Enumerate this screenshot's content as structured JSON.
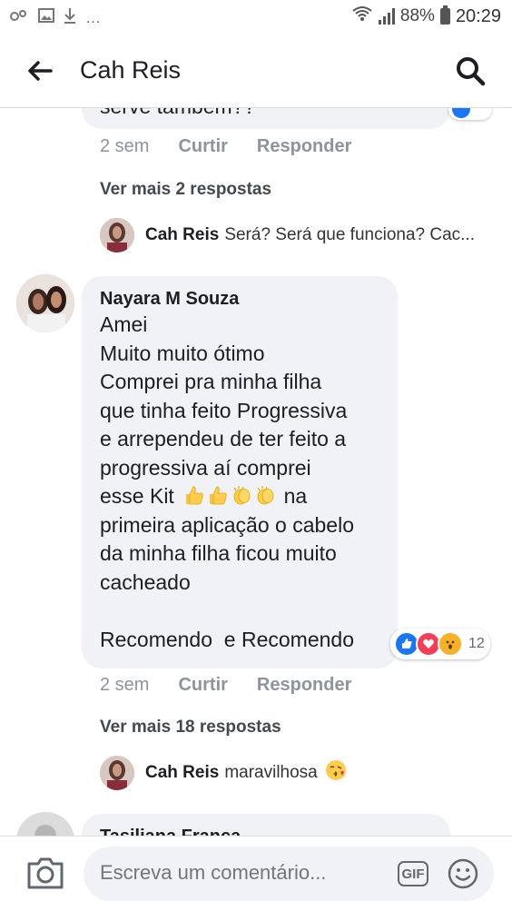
{
  "status_bar": {
    "battery": "88%",
    "time": "20:29"
  },
  "header": {
    "title": "Cah Reis"
  },
  "comment1": {
    "text_partial": "serve também??",
    "time": "2 sem",
    "like_label": "Curtir",
    "reply_label": "Responder",
    "more_replies": "Ver mais 2 respostas",
    "reply": {
      "name": "Cah Reis",
      "text": "Será? Será que funciona? Cac..."
    }
  },
  "comment2": {
    "author": "Nayara M Souza",
    "lines": [
      "Amei",
      "Muito muito ótimo",
      "Comprei pra minha filha",
      "que tinha feito Progressiva",
      "e arrependeu de ter feito a",
      "progressiva aí comprei"
    ],
    "line_with_emoji_prefix": "esse Kit",
    "line_with_emoji_suffix": "na",
    "lines_after": [
      "primeira aplicação o cabelo",
      "da minha filha ficou muito",
      "cacheado"
    ],
    "last_line": "Recomendo  e Recomendo",
    "reaction_count": "12",
    "time": "2 sem",
    "like_label": "Curtir",
    "reply_label": "Responder",
    "more_replies": "Ver mais 18 respostas",
    "reply": {
      "name": "Cah Reis",
      "text": "maravilhosa",
      "emoji": "😘"
    }
  },
  "comment3": {
    "author_partial": "Tasiliana Franca"
  },
  "composer": {
    "placeholder": "Escreva um comentário...",
    "gif_label": "GIF"
  },
  "colors": {
    "bubble": "#f0f2f5",
    "meta": "#8d949e",
    "like_blue": "#1877f2",
    "love_red": "#f33e58",
    "wow_yellow": "#f7b125"
  }
}
